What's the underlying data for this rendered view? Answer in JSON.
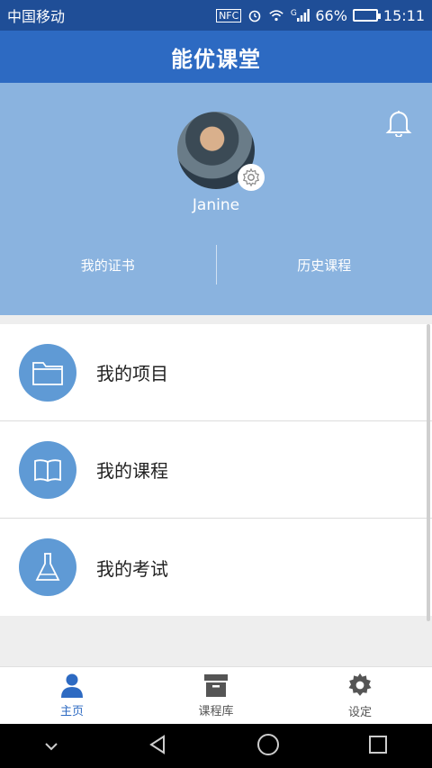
{
  "status_bar": {
    "carrier": "中国移动",
    "nfc": "NFC",
    "signal": "G",
    "battery_percent": "66%",
    "battery_level": 0.66,
    "time": "15:11"
  },
  "app_bar": {
    "title": "能优课堂"
  },
  "profile": {
    "username": "Janine",
    "links": [
      {
        "label": "我的证书"
      },
      {
        "label": "历史课程"
      }
    ]
  },
  "menu": {
    "items": [
      {
        "label": "我的项目",
        "icon": "folder-icon"
      },
      {
        "label": "我的课程",
        "icon": "book-icon"
      },
      {
        "label": "我的考试",
        "icon": "flask-icon"
      }
    ]
  },
  "bottom_nav": {
    "items": [
      {
        "label": "主页",
        "icon": "person-icon",
        "active": true
      },
      {
        "label": "课程库",
        "icon": "archive-icon",
        "active": false
      },
      {
        "label": "设定",
        "icon": "gear-icon",
        "active": false
      }
    ]
  },
  "colors": {
    "status_bar": "#1f4e97",
    "app_bar": "#2d6ac2",
    "profile_bg": "#8ab3df",
    "icon_circle": "#5f9ad5",
    "active_tab": "#2d6ac2"
  }
}
